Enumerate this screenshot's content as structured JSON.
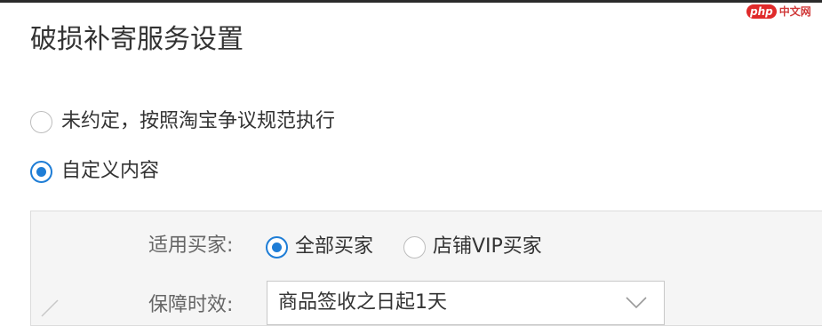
{
  "watermark": {
    "logo": "php",
    "text": "中文网"
  },
  "title": "破损补寄服务设置",
  "service_options": [
    {
      "label": "未约定，按照淘宝争议规范执行",
      "checked": false
    },
    {
      "label": "自定义内容",
      "checked": true
    }
  ],
  "custom_config": {
    "buyer_label": "适用买家:",
    "buyer_options": [
      {
        "label": "全部买家",
        "checked": true
      },
      {
        "label": "店铺VIP买家",
        "checked": false
      }
    ],
    "duration_label": "保障时效:",
    "duration_value": "商品签收之日起1天"
  },
  "icons": {
    "radio_checked": "radio-checked-icon",
    "radio_unchecked": "radio-unchecked-icon",
    "dropdown": "chevron-down-icon",
    "edit": "edit-mark-icon"
  },
  "colors": {
    "accent": "#1e7dd6",
    "panel_bg": "#f5f5f5",
    "text": "#333333",
    "label_text": "#666666"
  }
}
